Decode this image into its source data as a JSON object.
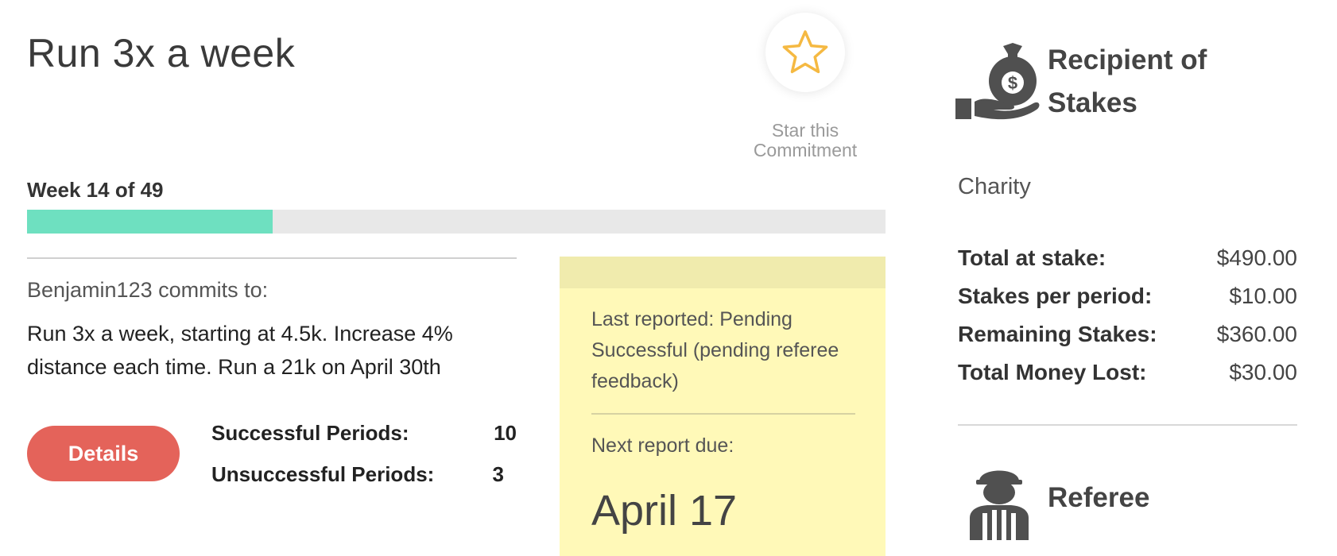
{
  "commitment": {
    "title": "Run 3x a week",
    "star_label_line1": "Star this",
    "star_label_line2": "Commitment",
    "star_icon": "star-outline-icon",
    "star_color": "#f5b942"
  },
  "progress": {
    "label": "Week 14 of 49",
    "current_week": 14,
    "total_weeks": 49,
    "fill_color": "#6ee0c0"
  },
  "description": {
    "commits_to": "Benjamin123 commits to:",
    "text": "Run 3x a week, starting at 4.5k. Increase 4% distance each time. Run a 21k on April 30th"
  },
  "actions": {
    "details_label": "Details",
    "details_color": "#e4635a"
  },
  "periods": {
    "successful_label": "Successful Periods:",
    "successful_value": "10",
    "unsuccessful_label": "Unsuccessful Periods:",
    "unsuccessful_value": "3"
  },
  "report": {
    "last_reported": "Last reported: Pending Successful (pending referee feedback)",
    "next_due_label": "Next report due:",
    "next_due_date": "April 17"
  },
  "stakes": {
    "icon": "money-bag-hand-icon",
    "title_line1": "Recipient of",
    "title_line2": "Stakes",
    "recipient": "Charity",
    "rows": [
      {
        "label": "Total at stake:",
        "value": "$490.00"
      },
      {
        "label": "Stakes per period:",
        "value": "$10.00"
      },
      {
        "label": "Remaining Stakes:",
        "value": "$360.00"
      },
      {
        "label": "Total Money Lost:",
        "value": "$30.00"
      }
    ]
  },
  "referee": {
    "icon": "referee-person-icon",
    "title": "Referee"
  }
}
